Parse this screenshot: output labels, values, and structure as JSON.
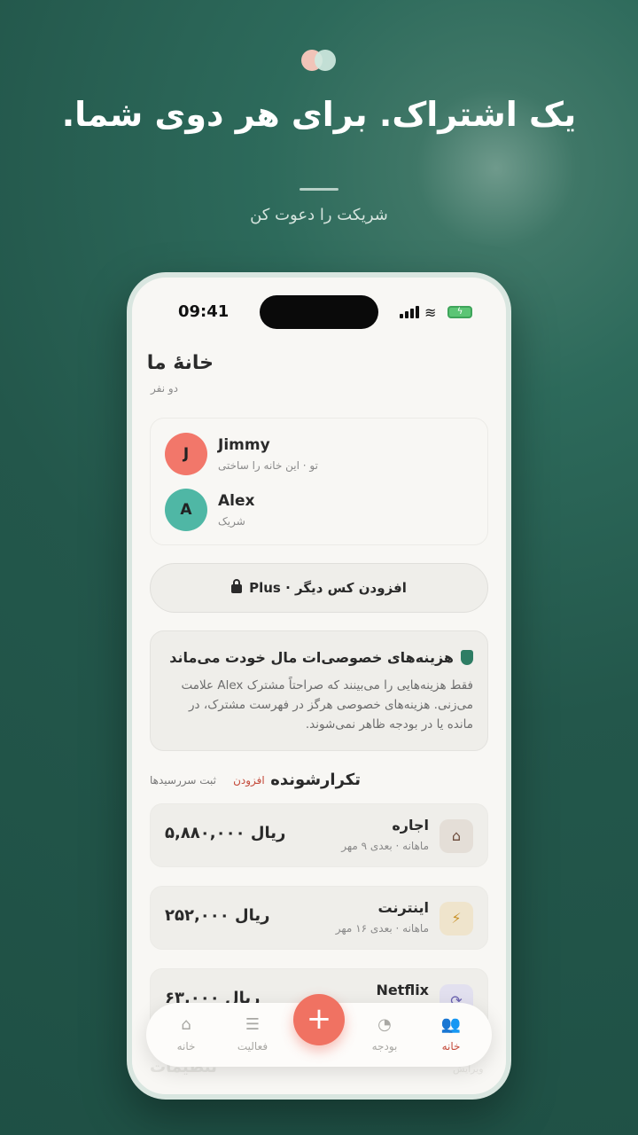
{
  "promo": {
    "headline": "یک اشتراک. برای هر دوی شما.",
    "subheadline": "شریکت را دعوت کن"
  },
  "status_bar": {
    "time": "09:41"
  },
  "household": {
    "title": "خانهٔ ما",
    "subtitle": "دو نفر",
    "members": [
      {
        "initial": "J",
        "name": "Jimmy",
        "role": "تو · این خانه را ساختی",
        "color": "#f2776a"
      },
      {
        "initial": "A",
        "name": "Alex",
        "role": "شریک",
        "color": "#4fb7a5"
      }
    ]
  },
  "add_person": {
    "label": "افزودن کس دیگر · Plus"
  },
  "privacy": {
    "title": "هزینه‌های خصوصی‌ات مال خودت می‌ماند",
    "body": "فقط هزینه‌هایی را می‌بینند که صراحتاً مشترک Alex علامت می‌زنی. هزینه‌های خصوصی هرگز در فهرست مشترک، در مانده یا در بودجه ظاهر نمی‌شوند."
  },
  "recurring": {
    "title": "تکرارشونده",
    "add_label": "افزودن",
    "log_label": "ثبت سررسیدها",
    "items": [
      {
        "name": "اجاره",
        "sub": "ماهانه · بعدی ۹ مهر",
        "amount": "ریال ۵,۸۸۰,۰۰۰",
        "icon": "home-icon",
        "glyph": "⌂",
        "bg": "#e4ded7",
        "fg": "#6b4a3a"
      },
      {
        "name": "اینترنت",
        "sub": "ماهانه · بعدی ۱۶ مهر",
        "amount": "ریال ۲۵۲,۰۰۰",
        "icon": "bolt-icon",
        "glyph": "⚡",
        "bg": "#efe4cc",
        "fg": "#c9922a"
      },
      {
        "name": "Netflix",
        "sub": "",
        "amount": "ریال ۶۳,۰۰۰",
        "icon": "repeat-icon",
        "glyph": "⟳",
        "bg": "#e2e0ef",
        "fg": "#6a62b0"
      }
    ]
  },
  "ghost": {
    "settings": "تنظیمات",
    "edit": "ویرایش"
  },
  "tabbar": {
    "tabs": [
      {
        "label": "خانه",
        "icon": "house-icon"
      },
      {
        "label": "فعالیت",
        "icon": "list-icon"
      },
      {
        "label": "بودجه",
        "icon": "pie-chart-icon"
      },
      {
        "label": "خانه",
        "icon": "people-icon"
      }
    ],
    "fab": "+"
  }
}
